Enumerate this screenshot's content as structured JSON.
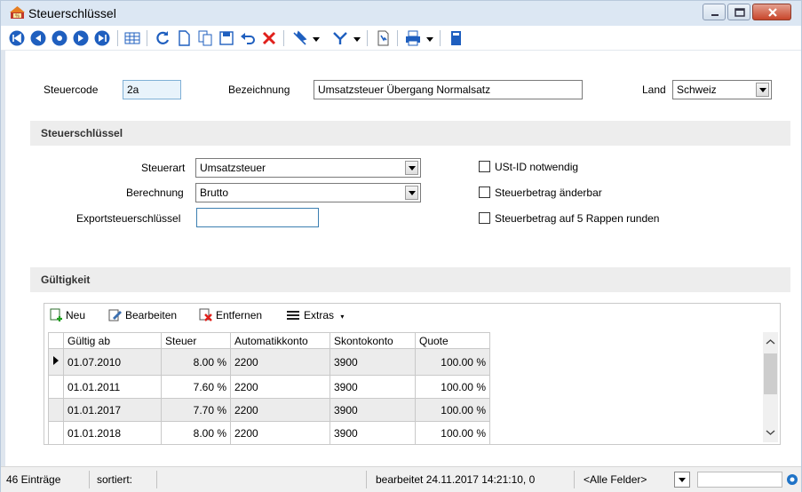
{
  "window": {
    "title": "Steuerschlüssel",
    "controls": [
      "minimize",
      "maximize",
      "close"
    ]
  },
  "toolbar": {
    "icons": [
      "first-record",
      "previous-record",
      "next-page",
      "next-record",
      "last-record",
      "table-view",
      "refresh",
      "new-document",
      "copy",
      "save",
      "undo",
      "delete",
      "pin",
      "filter",
      "document-search",
      "print",
      "info-book"
    ]
  },
  "header": {
    "steuercode_label": "Steuercode",
    "steuercode_value": "2a",
    "bezeichnung_label": "Bezeichnung",
    "bezeichnung_value": "Umsatzsteuer Übergang Normalsatz",
    "land_label": "Land",
    "land_value": "Schweiz"
  },
  "section_steuer": {
    "title": "Steuerschlüssel",
    "steuerart_label": "Steuerart",
    "steuerart_value": "Umsatzsteuer",
    "berechnung_label": "Berechnung",
    "berechnung_value": "Brutto",
    "export_label": "Exportsteuerschlüssel",
    "export_value": "",
    "check_ustid": "USt-ID notwendig",
    "check_aenderbar": "Steuerbetrag änderbar",
    "check_runden": "Steuerbetrag auf 5 Rappen runden"
  },
  "section_gueltigkeit": {
    "title": "Gültigkeit",
    "actions": {
      "neu": "Neu",
      "bearbeiten": "Bearbeiten",
      "entfernen": "Entfernen",
      "extras": "Extras"
    },
    "columns": [
      "Gültig ab",
      "Steuer",
      "Automatikkonto",
      "Skontokonto",
      "Quote"
    ],
    "rows": [
      [
        "01.07.2010",
        "8.00 %",
        "2200",
        "3900",
        "100.00 %"
      ],
      [
        "01.01.2011",
        "7.60 %",
        "2200",
        "3900",
        "100.00 %"
      ],
      [
        "01.01.2017",
        "7.70 %",
        "2200",
        "3900",
        "100.00 %"
      ],
      [
        "01.01.2018",
        "8.00 %",
        "2200",
        "3900",
        "100.00 %"
      ]
    ]
  },
  "statusbar": {
    "count": "46 Einträge",
    "sorted": "sortiert:",
    "edited": "bearbeitet 24.11.2017 14:21:10,  0",
    "field_filter": "<Alle Felder>"
  }
}
